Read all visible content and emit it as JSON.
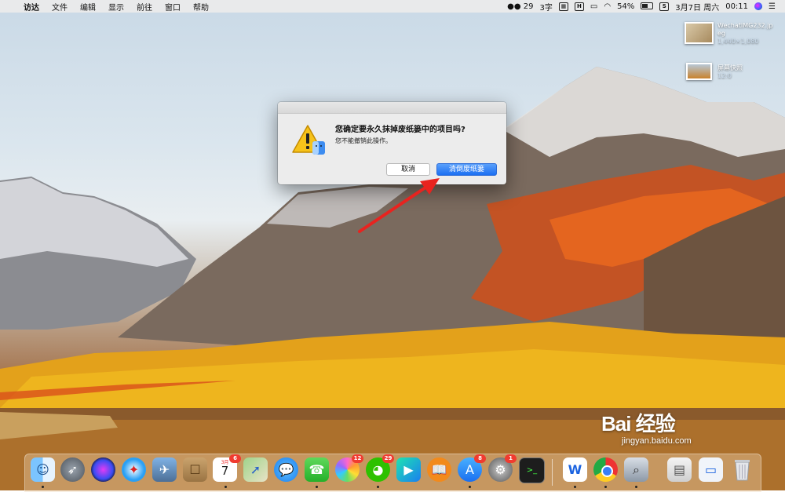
{
  "menubar": {
    "apple": "",
    "items": [
      "访达",
      "文件",
      "编辑",
      "显示",
      "前往",
      "窗口",
      "帮助"
    ],
    "status": {
      "wechat_count": "29",
      "input_method": "3字",
      "battery": "54%",
      "date": "3月7日 周六",
      "time": "00:11"
    }
  },
  "desktop": {
    "file1_line1": "WechatIMG232.jp",
    "file1_line2": "eg",
    "file1_line3": "1,440×1,080",
    "file2_line1": "屏幕快照",
    "file2_line2": "12:0"
  },
  "dialog": {
    "title": "您确定要永久抹掉废纸篓中的项目吗?",
    "message": "您不能撤销此操作。",
    "cancel_label": "取消",
    "confirm_label": "清倒废纸篓"
  },
  "dock": {
    "badges": {
      "calendar": "6",
      "photos": "12",
      "wechat": "29",
      "appstore": "8",
      "preferences": "1"
    },
    "calendar_day": "7",
    "calendar_month": "3月"
  },
  "watermark": {
    "logo": "Bai  经验",
    "url": "jingyan.baidu.com"
  },
  "colors": {
    "accent": "#1c6ff2",
    "badge": "#f03b30",
    "arrow": "#e8231f"
  }
}
